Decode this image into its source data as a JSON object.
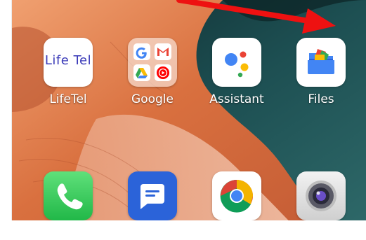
{
  "apps_row1": [
    {
      "name": "LifeTel",
      "icon_text": "Life Tel",
      "icon": "lifetel-logo-icon"
    },
    {
      "name": "Google",
      "icon": "google-folder-icon"
    },
    {
      "name": "Assistant",
      "icon": "assistant-icon"
    },
    {
      "name": "Files",
      "icon": "files-icon"
    }
  ],
  "dock": [
    {
      "icon": "phone-icon"
    },
    {
      "icon": "messages-icon"
    },
    {
      "icon": "chrome-icon"
    },
    {
      "icon": "camera-icon"
    }
  ],
  "colors": {
    "arrow": "#ee1111",
    "lifetel_text": "#3a3ab8",
    "wallpaper_orange": "#e07a45",
    "wallpaper_teal": "#1c4a4c"
  }
}
